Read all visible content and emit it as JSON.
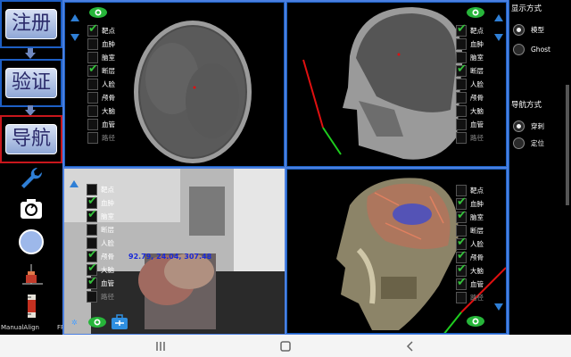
{
  "sidebar": {
    "steps": [
      {
        "label": "注册",
        "active": false
      },
      {
        "label": "验证",
        "active": false
      },
      {
        "label": "导航",
        "active": true
      }
    ],
    "tools": [
      "wrench-icon",
      "camera-switch-icon",
      "record-circle-icon",
      "tracker-icon",
      "ruler-icon"
    ],
    "manual_align": "ManualAlign",
    "fps": "FPS"
  },
  "layers_full": [
    "靶点",
    "血肿",
    "脑室",
    "断层",
    "人脸",
    "颅骨",
    "大脑",
    "血管",
    "路径"
  ],
  "viewports": {
    "axial": {
      "checked": [
        0,
        3
      ]
    },
    "sagittal": {
      "checked": [
        0,
        3
      ]
    },
    "camera": {
      "checked": [
        1,
        2,
        5,
        6,
        7
      ],
      "tracking_text": "92.79, 24.04, 307.48"
    },
    "model3d": {
      "checked": [
        1,
        2,
        4,
        5,
        6,
        7
      ]
    }
  },
  "panel": {
    "display_mode_title": "显示方式",
    "display_modes": [
      {
        "label": "模型",
        "selected": true
      },
      {
        "label": "Ghost",
        "selected": false
      }
    ],
    "nav_mode_title": "导航方式",
    "nav_modes": [
      {
        "label": "穿刺",
        "selected": true
      },
      {
        "label": "定位",
        "selected": false
      }
    ]
  },
  "colors": {
    "accent": "#1d5fc5",
    "active_step": "#c8161c",
    "check": "#34c23b",
    "trajectory_red": "#e01010",
    "trajectory_green": "#1ecc1e"
  }
}
